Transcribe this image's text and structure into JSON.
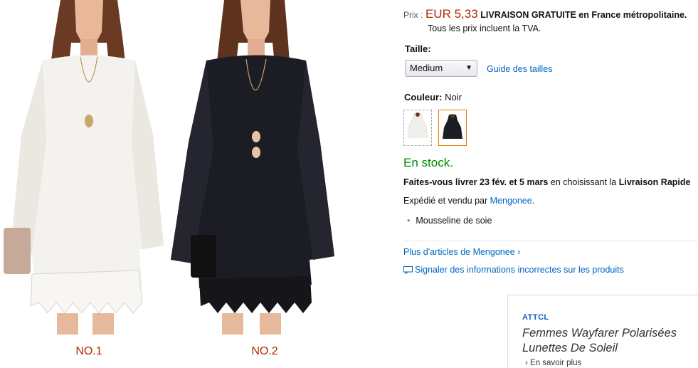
{
  "images": {
    "label_1": "NO.1",
    "label_2": "NO.2"
  },
  "price": {
    "label": "Prix :",
    "value": "EUR 5,33",
    "shipping": "LIVRAISON GRATUITE en France métropolitaine.",
    "tax_note": "Tous les prix incluent la TVA."
  },
  "size": {
    "label": "Taille:",
    "selected": "Medium",
    "guide_link": "Guide des tailles"
  },
  "color": {
    "label": "Couleur:",
    "selected": "Noir"
  },
  "stock": "En stock.",
  "delivery": {
    "prefix": "Faites-vous livrer",
    "dates": "23 fév. et 5 mars",
    "middle": "en choisissant la",
    "option": "Livraison Rapide"
  },
  "seller": {
    "prefix": "Expédié et vendu par",
    "name": "Mengonee",
    "suffix": "."
  },
  "bullets": [
    "Mousseline de soie"
  ],
  "more_link": "Plus d'articles de Mengonee ›",
  "report_link": "Signaler des informations incorrectes sur les produits",
  "ad": {
    "brand": "ATTCL",
    "title": "Femmes Wayfarer Polarisées Lunettes De Soleil",
    "more": "› En savoir plus"
  },
  "colors": {
    "price": "#b12704",
    "link": "#0066c0",
    "stock": "#008a00",
    "selected_swatch_border": "#e77600"
  }
}
